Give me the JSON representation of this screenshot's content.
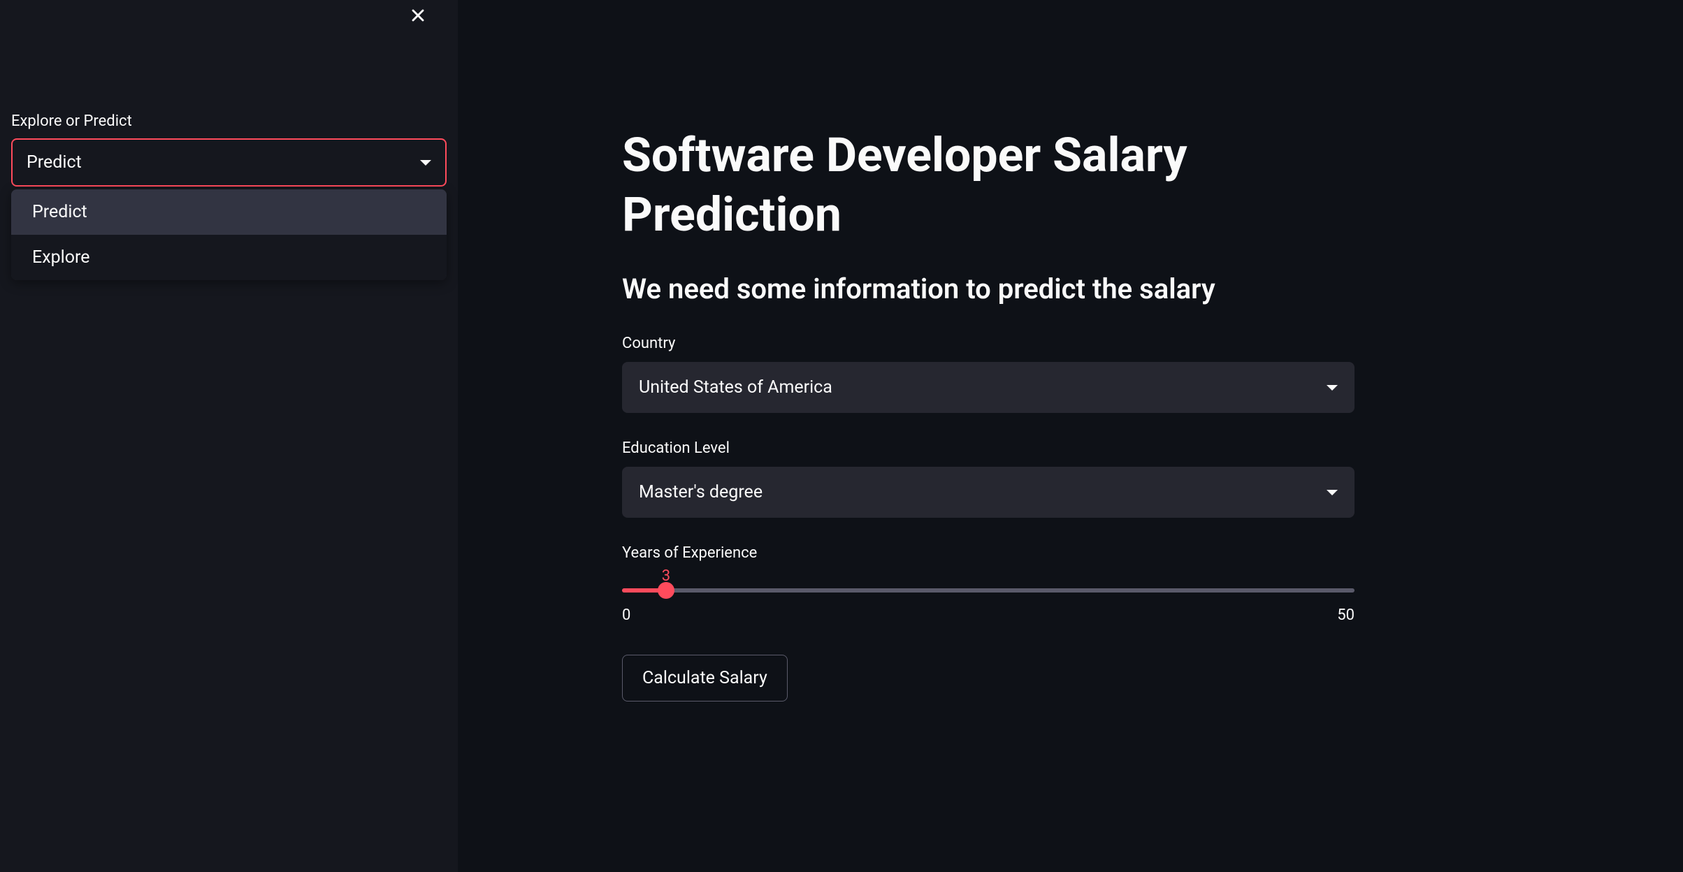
{
  "sidebar": {
    "mode_label": "Explore or Predict",
    "mode_selected": "Predict",
    "mode_options": [
      "Predict",
      "Explore"
    ]
  },
  "main": {
    "title": "Software Developer Salary Prediction",
    "subtitle": "We need some information to predict the salary",
    "country": {
      "label": "Country",
      "selected": "United States of America"
    },
    "education": {
      "label": "Education Level",
      "selected": "Master's degree"
    },
    "experience": {
      "label": "Years of Experience",
      "value": "3",
      "min": "0",
      "max": "50"
    },
    "calculate_button": "Calculate Salary"
  },
  "colors": {
    "accent": "#ff4b5c",
    "bg_main": "#0e1117",
    "bg_sidebar": "#15171e",
    "bg_input": "#262730"
  }
}
